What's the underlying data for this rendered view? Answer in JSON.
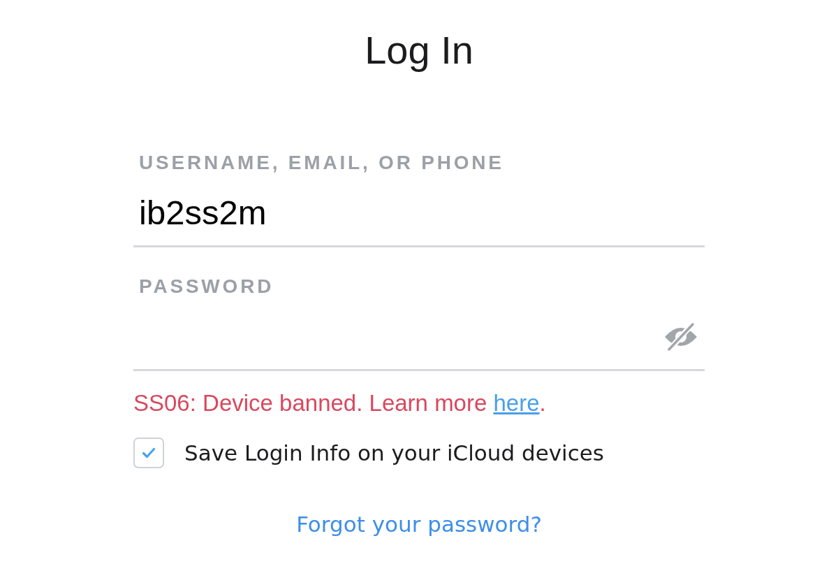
{
  "title": "Log In",
  "fields": [
    {
      "kind": "text",
      "label": "USERNAME, EMAIL, OR PHONE",
      "value": "ib2ss2m"
    },
    {
      "kind": "password",
      "label": "PASSWORD",
      "password_visible": false
    }
  ],
  "error": {
    "text": "SS06: Device banned. Learn more ",
    "link": "here",
    "after": "."
  },
  "save_login": {
    "label": "Save Login Info on your iCloud devices",
    "checked": true
  },
  "forgot_link": "Forgot your password?"
}
